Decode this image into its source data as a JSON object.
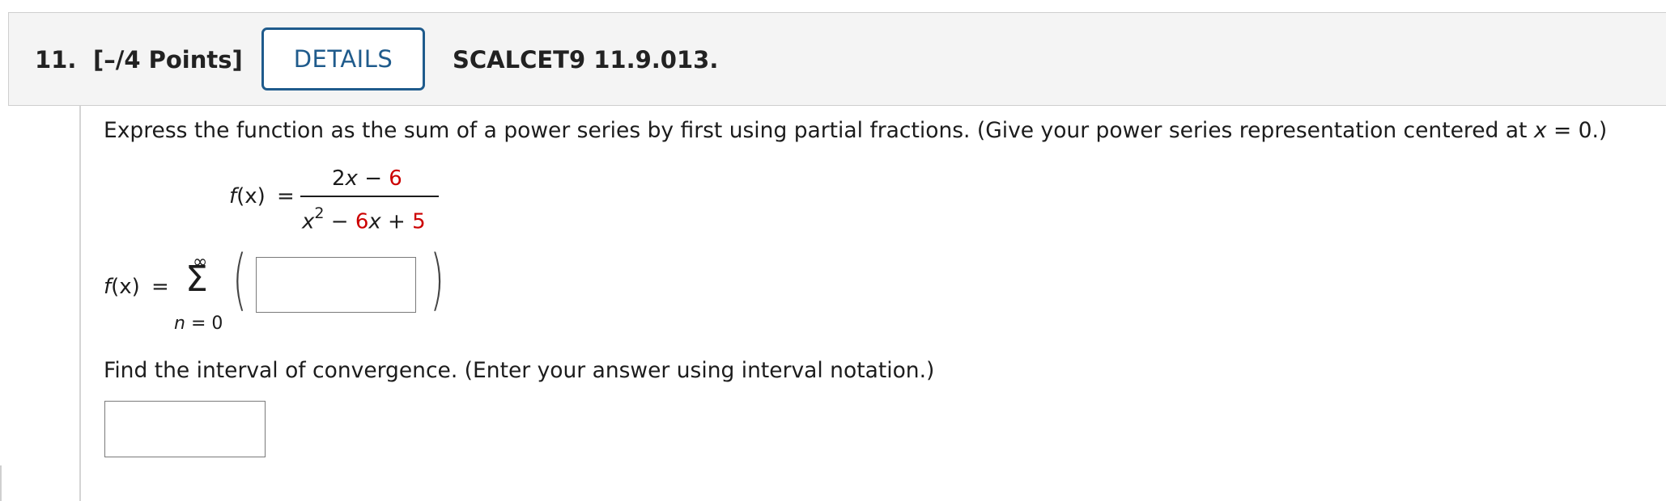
{
  "question": {
    "number": "11.",
    "points": "[–/4 Points]",
    "details_label": "DETAILS",
    "source": "SCALCET9 11.9.013."
  },
  "prompt": {
    "instruction_pre": "Express the function as the sum of a power series by first using partial fractions. (Give your power series representation centered at ",
    "instruction_var": "x",
    "instruction_post": " = 0.)",
    "function": {
      "lhs_f": "f",
      "lhs_rest": "(x)",
      "equals": "=",
      "num_a": "2",
      "num_x": "x",
      "num_minus": " − ",
      "num_const": "6",
      "den_x": "x",
      "den_exp": "2",
      "den_minus": " − ",
      "den_coef": "6",
      "den_x2": "x",
      "den_plus": " + ",
      "den_const": "5"
    },
    "series": {
      "lhs_f": "f",
      "lhs_rest": "(x)",
      "equals": "=",
      "upper_limit": "∞",
      "sigma": "Σ",
      "lower_var": "n",
      "lower_rest": " = 0",
      "paren_open": "(",
      "paren_close": ")",
      "answer_value": ""
    },
    "find_instruction": "Find the interval of convergence. (Enter your answer using interval notation.)",
    "interval_value": ""
  },
  "colors": {
    "accent": "#1f5b8c",
    "highlight_red": "#cc0000",
    "header_bg": "#f4f4f4"
  }
}
